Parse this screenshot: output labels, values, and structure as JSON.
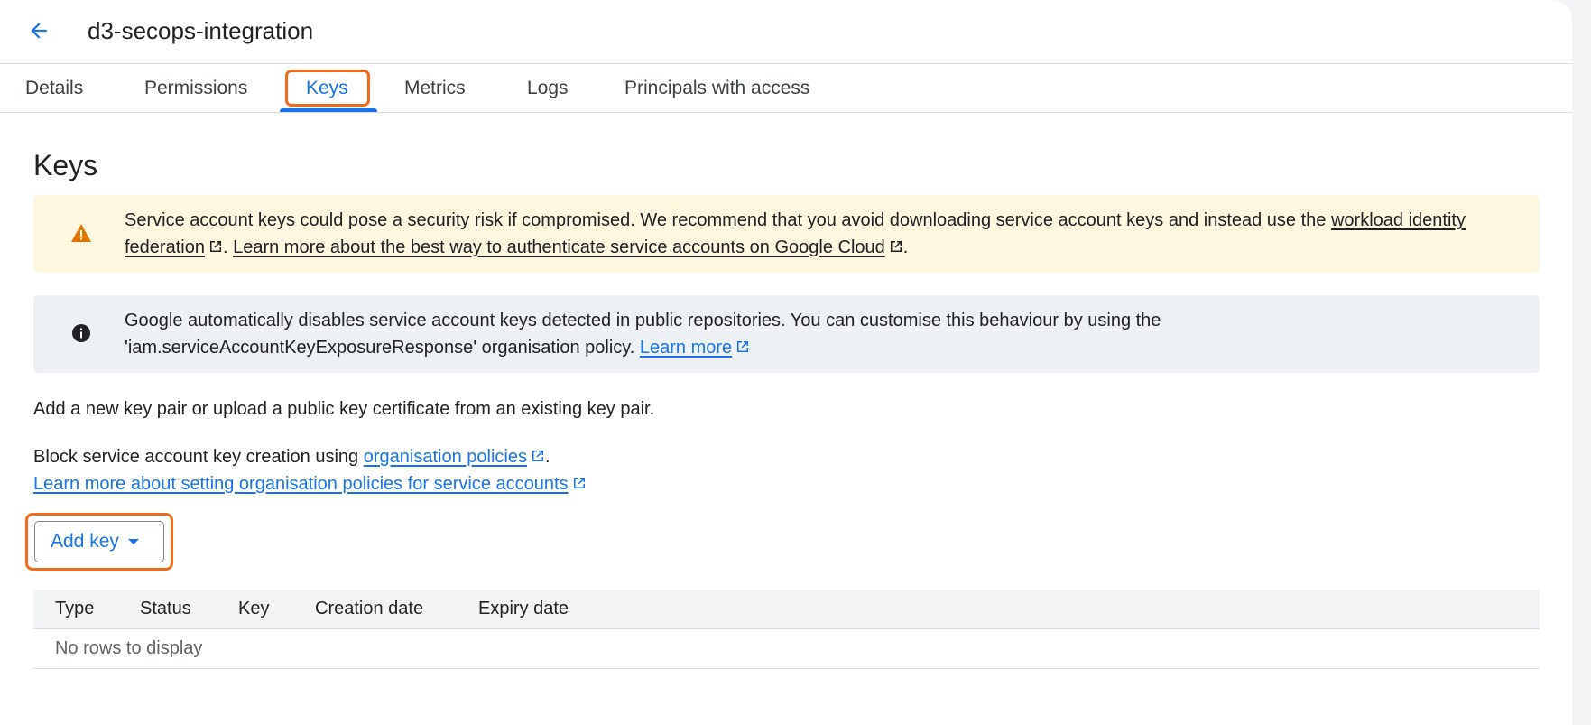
{
  "header": {
    "title": "d3-secops-integration",
    "back_icon": "arrow-left-icon"
  },
  "tabs": [
    {
      "label": "Details",
      "active": false
    },
    {
      "label": "Permissions",
      "active": false
    },
    {
      "label": "Keys",
      "active": true
    },
    {
      "label": "Metrics",
      "active": false
    },
    {
      "label": "Logs",
      "active": false
    },
    {
      "label": "Principals with access",
      "active": false
    }
  ],
  "section": {
    "title": "Keys"
  },
  "warning_banner": {
    "icon": "warning-icon",
    "text_before": "Service account keys could pose a security risk if compromised. We recommend that you avoid downloading service account keys and instead use the ",
    "link1": "workload identity federation",
    "text_middle": ". ",
    "link2": "Learn more about the best way to authenticate service accounts on Google Cloud",
    "text_after": "."
  },
  "info_banner": {
    "icon": "info-icon",
    "text_line1": "Google automatically disables service account keys detected in public repositories. You can customise this behaviour by using the",
    "text_line2": "'iam.serviceAccountKeyExposureResponse' organisation policy. ",
    "link": "Learn more"
  },
  "description": "Add a new key pair or upload a public key certificate from an existing key pair.",
  "block_text": {
    "before": "Block service account key creation using ",
    "link": "organisation policies",
    "after": "."
  },
  "learn_more_policies_link": "Learn more about setting organisation policies for service accounts",
  "add_key_button": {
    "label": "Add key",
    "icon": "caret-down-icon"
  },
  "table": {
    "columns": [
      "Type",
      "Status",
      "Key",
      "Creation date",
      "Expiry date"
    ],
    "empty_message": "No rows to display"
  },
  "colors": {
    "accent": "#1a73e8",
    "highlight": "#f26b1d",
    "warning_bg": "#fef7e0",
    "warning_icon": "#e37400",
    "info_bg": "#edf0f4"
  }
}
